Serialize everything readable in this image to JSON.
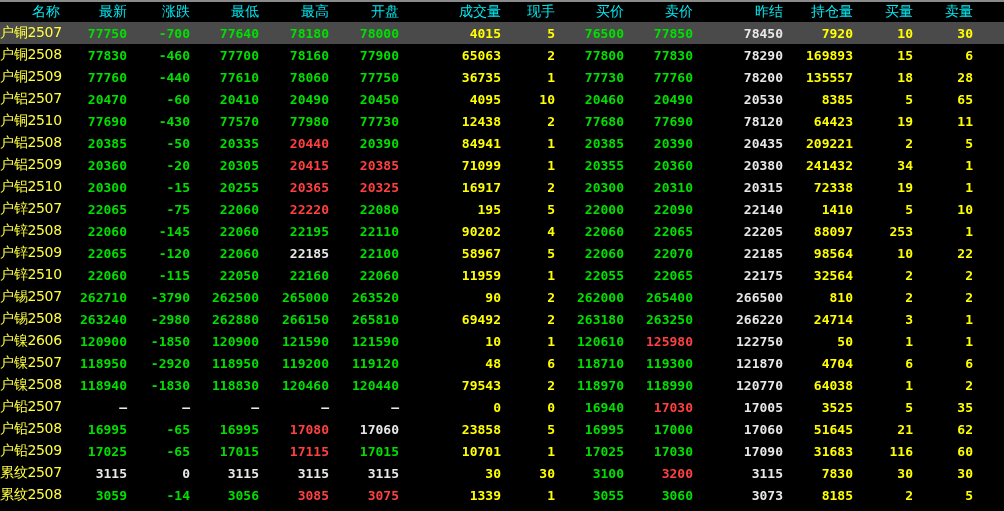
{
  "table": {
    "columns": [
      "名称",
      "最新",
      "涨跌",
      "最低",
      "最高",
      "开盘",
      "成交量",
      "现手",
      "买价",
      "卖价",
      "昨结",
      "持仓量",
      "买量",
      "卖量"
    ],
    "rows": [
      {
        "selected": true,
        "cells": [
          {
            "text": "户铜2507",
            "kind": "name"
          },
          {
            "text": "77750",
            "kind": "down"
          },
          {
            "text": "-700",
            "kind": "down"
          },
          {
            "text": "77640",
            "kind": "down"
          },
          {
            "text": "78180",
            "kind": "down"
          },
          {
            "text": "78000",
            "kind": "down"
          },
          {
            "text": "4015",
            "kind": "vol"
          },
          {
            "text": "5",
            "kind": "vol"
          },
          {
            "text": "76500",
            "kind": "down"
          },
          {
            "text": "77850",
            "kind": "down"
          },
          {
            "text": "78450",
            "kind": "flat"
          },
          {
            "text": "7920",
            "kind": "vol"
          },
          {
            "text": "10",
            "kind": "vol"
          },
          {
            "text": "30",
            "kind": "vol"
          }
        ]
      },
      {
        "selected": false,
        "cells": [
          {
            "text": "户铜2508",
            "kind": "name"
          },
          {
            "text": "77830",
            "kind": "down"
          },
          {
            "text": "-460",
            "kind": "down"
          },
          {
            "text": "77700",
            "kind": "down"
          },
          {
            "text": "78160",
            "kind": "down"
          },
          {
            "text": "77900",
            "kind": "down"
          },
          {
            "text": "65063",
            "kind": "vol"
          },
          {
            "text": "2",
            "kind": "vol"
          },
          {
            "text": "77800",
            "kind": "down"
          },
          {
            "text": "77830",
            "kind": "down"
          },
          {
            "text": "78290",
            "kind": "flat"
          },
          {
            "text": "169893",
            "kind": "vol"
          },
          {
            "text": "15",
            "kind": "vol"
          },
          {
            "text": "6",
            "kind": "vol"
          }
        ]
      },
      {
        "selected": false,
        "cells": [
          {
            "text": "户铜2509",
            "kind": "name"
          },
          {
            "text": "77760",
            "kind": "down"
          },
          {
            "text": "-440",
            "kind": "down"
          },
          {
            "text": "77610",
            "kind": "down"
          },
          {
            "text": "78060",
            "kind": "down"
          },
          {
            "text": "77750",
            "kind": "down"
          },
          {
            "text": "36735",
            "kind": "vol"
          },
          {
            "text": "1",
            "kind": "vol"
          },
          {
            "text": "77730",
            "kind": "down"
          },
          {
            "text": "77760",
            "kind": "down"
          },
          {
            "text": "78200",
            "kind": "flat"
          },
          {
            "text": "135557",
            "kind": "vol"
          },
          {
            "text": "18",
            "kind": "vol"
          },
          {
            "text": "28",
            "kind": "vol"
          }
        ]
      },
      {
        "selected": false,
        "cells": [
          {
            "text": "户铝2507",
            "kind": "name"
          },
          {
            "text": "20470",
            "kind": "down"
          },
          {
            "text": "-60",
            "kind": "down"
          },
          {
            "text": "20410",
            "kind": "down"
          },
          {
            "text": "20490",
            "kind": "down"
          },
          {
            "text": "20450",
            "kind": "down"
          },
          {
            "text": "4095",
            "kind": "vol"
          },
          {
            "text": "10",
            "kind": "vol"
          },
          {
            "text": "20460",
            "kind": "down"
          },
          {
            "text": "20490",
            "kind": "down"
          },
          {
            "text": "20530",
            "kind": "flat"
          },
          {
            "text": "8385",
            "kind": "vol"
          },
          {
            "text": "5",
            "kind": "vol"
          },
          {
            "text": "65",
            "kind": "vol"
          }
        ]
      },
      {
        "selected": false,
        "cells": [
          {
            "text": "户铜2510",
            "kind": "name"
          },
          {
            "text": "77690",
            "kind": "down"
          },
          {
            "text": "-430",
            "kind": "down"
          },
          {
            "text": "77570",
            "kind": "down"
          },
          {
            "text": "77980",
            "kind": "down"
          },
          {
            "text": "77730",
            "kind": "down"
          },
          {
            "text": "12438",
            "kind": "vol"
          },
          {
            "text": "2",
            "kind": "vol"
          },
          {
            "text": "77680",
            "kind": "down"
          },
          {
            "text": "77690",
            "kind": "down"
          },
          {
            "text": "78120",
            "kind": "flat"
          },
          {
            "text": "64423",
            "kind": "vol"
          },
          {
            "text": "19",
            "kind": "vol"
          },
          {
            "text": "11",
            "kind": "vol"
          }
        ]
      },
      {
        "selected": false,
        "cells": [
          {
            "text": "户铝2508",
            "kind": "name"
          },
          {
            "text": "20385",
            "kind": "down"
          },
          {
            "text": "-50",
            "kind": "down"
          },
          {
            "text": "20335",
            "kind": "down"
          },
          {
            "text": "20440",
            "kind": "up"
          },
          {
            "text": "20390",
            "kind": "down"
          },
          {
            "text": "84941",
            "kind": "vol"
          },
          {
            "text": "1",
            "kind": "vol"
          },
          {
            "text": "20385",
            "kind": "down"
          },
          {
            "text": "20390",
            "kind": "down"
          },
          {
            "text": "20435",
            "kind": "flat"
          },
          {
            "text": "209221",
            "kind": "vol"
          },
          {
            "text": "2",
            "kind": "vol"
          },
          {
            "text": "5",
            "kind": "vol"
          }
        ]
      },
      {
        "selected": false,
        "cells": [
          {
            "text": "户铝2509",
            "kind": "name"
          },
          {
            "text": "20360",
            "kind": "down"
          },
          {
            "text": "-20",
            "kind": "down"
          },
          {
            "text": "20305",
            "kind": "down"
          },
          {
            "text": "20415",
            "kind": "up"
          },
          {
            "text": "20385",
            "kind": "up"
          },
          {
            "text": "71099",
            "kind": "vol"
          },
          {
            "text": "1",
            "kind": "vol"
          },
          {
            "text": "20355",
            "kind": "down"
          },
          {
            "text": "20360",
            "kind": "down"
          },
          {
            "text": "20380",
            "kind": "flat"
          },
          {
            "text": "241432",
            "kind": "vol"
          },
          {
            "text": "34",
            "kind": "vol"
          },
          {
            "text": "1",
            "kind": "vol"
          }
        ]
      },
      {
        "selected": false,
        "cells": [
          {
            "text": "户铝2510",
            "kind": "name"
          },
          {
            "text": "20300",
            "kind": "down"
          },
          {
            "text": "-15",
            "kind": "down"
          },
          {
            "text": "20255",
            "kind": "down"
          },
          {
            "text": "20365",
            "kind": "up"
          },
          {
            "text": "20325",
            "kind": "up"
          },
          {
            "text": "16917",
            "kind": "vol"
          },
          {
            "text": "2",
            "kind": "vol"
          },
          {
            "text": "20300",
            "kind": "down"
          },
          {
            "text": "20310",
            "kind": "down"
          },
          {
            "text": "20315",
            "kind": "flat"
          },
          {
            "text": "72338",
            "kind": "vol"
          },
          {
            "text": "19",
            "kind": "vol"
          },
          {
            "text": "1",
            "kind": "vol"
          }
        ]
      },
      {
        "selected": false,
        "cells": [
          {
            "text": "户锌2507",
            "kind": "name"
          },
          {
            "text": "22065",
            "kind": "down"
          },
          {
            "text": "-75",
            "kind": "down"
          },
          {
            "text": "22060",
            "kind": "down"
          },
          {
            "text": "22220",
            "kind": "up"
          },
          {
            "text": "22080",
            "kind": "down"
          },
          {
            "text": "195",
            "kind": "vol"
          },
          {
            "text": "5",
            "kind": "vol"
          },
          {
            "text": "22000",
            "kind": "down"
          },
          {
            "text": "22090",
            "kind": "down"
          },
          {
            "text": "22140",
            "kind": "flat"
          },
          {
            "text": "1410",
            "kind": "vol"
          },
          {
            "text": "5",
            "kind": "vol"
          },
          {
            "text": "10",
            "kind": "vol"
          }
        ]
      },
      {
        "selected": false,
        "cells": [
          {
            "text": "户锌2508",
            "kind": "name"
          },
          {
            "text": "22060",
            "kind": "down"
          },
          {
            "text": "-145",
            "kind": "down"
          },
          {
            "text": "22060",
            "kind": "down"
          },
          {
            "text": "22195",
            "kind": "down"
          },
          {
            "text": "22110",
            "kind": "down"
          },
          {
            "text": "90202",
            "kind": "vol"
          },
          {
            "text": "4",
            "kind": "vol"
          },
          {
            "text": "22060",
            "kind": "down"
          },
          {
            "text": "22065",
            "kind": "down"
          },
          {
            "text": "22205",
            "kind": "flat"
          },
          {
            "text": "88097",
            "kind": "vol"
          },
          {
            "text": "253",
            "kind": "vol"
          },
          {
            "text": "1",
            "kind": "vol"
          }
        ]
      },
      {
        "selected": false,
        "cells": [
          {
            "text": "户锌2509",
            "kind": "name"
          },
          {
            "text": "22065",
            "kind": "down"
          },
          {
            "text": "-120",
            "kind": "down"
          },
          {
            "text": "22060",
            "kind": "down"
          },
          {
            "text": "22185",
            "kind": "flat"
          },
          {
            "text": "22100",
            "kind": "down"
          },
          {
            "text": "58967",
            "kind": "vol"
          },
          {
            "text": "5",
            "kind": "vol"
          },
          {
            "text": "22060",
            "kind": "down"
          },
          {
            "text": "22070",
            "kind": "down"
          },
          {
            "text": "22185",
            "kind": "flat"
          },
          {
            "text": "98564",
            "kind": "vol"
          },
          {
            "text": "10",
            "kind": "vol"
          },
          {
            "text": "22",
            "kind": "vol"
          }
        ]
      },
      {
        "selected": false,
        "cells": [
          {
            "text": "户锌2510",
            "kind": "name"
          },
          {
            "text": "22060",
            "kind": "down"
          },
          {
            "text": "-115",
            "kind": "down"
          },
          {
            "text": "22050",
            "kind": "down"
          },
          {
            "text": "22160",
            "kind": "down"
          },
          {
            "text": "22060",
            "kind": "down"
          },
          {
            "text": "11959",
            "kind": "vol"
          },
          {
            "text": "1",
            "kind": "vol"
          },
          {
            "text": "22055",
            "kind": "down"
          },
          {
            "text": "22065",
            "kind": "down"
          },
          {
            "text": "22175",
            "kind": "flat"
          },
          {
            "text": "32564",
            "kind": "vol"
          },
          {
            "text": "2",
            "kind": "vol"
          },
          {
            "text": "2",
            "kind": "vol"
          }
        ]
      },
      {
        "selected": false,
        "cells": [
          {
            "text": "户锡2507",
            "kind": "name"
          },
          {
            "text": "262710",
            "kind": "down"
          },
          {
            "text": "-3790",
            "kind": "down"
          },
          {
            "text": "262500",
            "kind": "down"
          },
          {
            "text": "265000",
            "kind": "down"
          },
          {
            "text": "263520",
            "kind": "down"
          },
          {
            "text": "90",
            "kind": "vol"
          },
          {
            "text": "2",
            "kind": "vol"
          },
          {
            "text": "262000",
            "kind": "down"
          },
          {
            "text": "265400",
            "kind": "down"
          },
          {
            "text": "266500",
            "kind": "flat"
          },
          {
            "text": "810",
            "kind": "vol"
          },
          {
            "text": "2",
            "kind": "vol"
          },
          {
            "text": "2",
            "kind": "vol"
          }
        ]
      },
      {
        "selected": false,
        "cells": [
          {
            "text": "户锡2508",
            "kind": "name"
          },
          {
            "text": "263240",
            "kind": "down"
          },
          {
            "text": "-2980",
            "kind": "down"
          },
          {
            "text": "262880",
            "kind": "down"
          },
          {
            "text": "266150",
            "kind": "down"
          },
          {
            "text": "265810",
            "kind": "down"
          },
          {
            "text": "69492",
            "kind": "vol"
          },
          {
            "text": "2",
            "kind": "vol"
          },
          {
            "text": "263180",
            "kind": "down"
          },
          {
            "text": "263250",
            "kind": "down"
          },
          {
            "text": "266220",
            "kind": "flat"
          },
          {
            "text": "24714",
            "kind": "vol"
          },
          {
            "text": "3",
            "kind": "vol"
          },
          {
            "text": "1",
            "kind": "vol"
          }
        ]
      },
      {
        "selected": false,
        "cells": [
          {
            "text": "户镍2606",
            "kind": "name"
          },
          {
            "text": "120900",
            "kind": "down"
          },
          {
            "text": "-1850",
            "kind": "down"
          },
          {
            "text": "120900",
            "kind": "down"
          },
          {
            "text": "121590",
            "kind": "down"
          },
          {
            "text": "121590",
            "kind": "down"
          },
          {
            "text": "10",
            "kind": "vol"
          },
          {
            "text": "1",
            "kind": "vol"
          },
          {
            "text": "120610",
            "kind": "down"
          },
          {
            "text": "125980",
            "kind": "up"
          },
          {
            "text": "122750",
            "kind": "flat"
          },
          {
            "text": "50",
            "kind": "vol"
          },
          {
            "text": "1",
            "kind": "vol"
          },
          {
            "text": "1",
            "kind": "vol"
          }
        ]
      },
      {
        "selected": false,
        "cells": [
          {
            "text": "户镍2507",
            "kind": "name"
          },
          {
            "text": "118950",
            "kind": "down"
          },
          {
            "text": "-2920",
            "kind": "down"
          },
          {
            "text": "118950",
            "kind": "down"
          },
          {
            "text": "119200",
            "kind": "down"
          },
          {
            "text": "119120",
            "kind": "down"
          },
          {
            "text": "48",
            "kind": "vol"
          },
          {
            "text": "6",
            "kind": "vol"
          },
          {
            "text": "118710",
            "kind": "down"
          },
          {
            "text": "119300",
            "kind": "down"
          },
          {
            "text": "121870",
            "kind": "flat"
          },
          {
            "text": "4704",
            "kind": "vol"
          },
          {
            "text": "6",
            "kind": "vol"
          },
          {
            "text": "6",
            "kind": "vol"
          }
        ]
      },
      {
        "selected": false,
        "cells": [
          {
            "text": "户镍2508",
            "kind": "name"
          },
          {
            "text": "118940",
            "kind": "down"
          },
          {
            "text": "-1830",
            "kind": "down"
          },
          {
            "text": "118830",
            "kind": "down"
          },
          {
            "text": "120460",
            "kind": "down"
          },
          {
            "text": "120440",
            "kind": "down"
          },
          {
            "text": "79543",
            "kind": "vol"
          },
          {
            "text": "2",
            "kind": "vol"
          },
          {
            "text": "118970",
            "kind": "down"
          },
          {
            "text": "118990",
            "kind": "down"
          },
          {
            "text": "120770",
            "kind": "flat"
          },
          {
            "text": "64038",
            "kind": "vol"
          },
          {
            "text": "1",
            "kind": "vol"
          },
          {
            "text": "2",
            "kind": "vol"
          }
        ]
      },
      {
        "selected": false,
        "cells": [
          {
            "text": "户铅2507",
            "kind": "name"
          },
          {
            "text": "—",
            "kind": "flat"
          },
          {
            "text": "—",
            "kind": "flat"
          },
          {
            "text": "—",
            "kind": "flat"
          },
          {
            "text": "—",
            "kind": "flat"
          },
          {
            "text": "—",
            "kind": "flat"
          },
          {
            "text": "0",
            "kind": "vol"
          },
          {
            "text": "0",
            "kind": "vol"
          },
          {
            "text": "16940",
            "kind": "down"
          },
          {
            "text": "17030",
            "kind": "up"
          },
          {
            "text": "17005",
            "kind": "flat"
          },
          {
            "text": "3525",
            "kind": "vol"
          },
          {
            "text": "5",
            "kind": "vol"
          },
          {
            "text": "35",
            "kind": "vol"
          }
        ]
      },
      {
        "selected": false,
        "cells": [
          {
            "text": "户铅2508",
            "kind": "name"
          },
          {
            "text": "16995",
            "kind": "down"
          },
          {
            "text": "-65",
            "kind": "down"
          },
          {
            "text": "16995",
            "kind": "down"
          },
          {
            "text": "17080",
            "kind": "up"
          },
          {
            "text": "17060",
            "kind": "flat"
          },
          {
            "text": "23858",
            "kind": "vol"
          },
          {
            "text": "5",
            "kind": "vol"
          },
          {
            "text": "16995",
            "kind": "down"
          },
          {
            "text": "17000",
            "kind": "down"
          },
          {
            "text": "17060",
            "kind": "flat"
          },
          {
            "text": "51645",
            "kind": "vol"
          },
          {
            "text": "21",
            "kind": "vol"
          },
          {
            "text": "62",
            "kind": "vol"
          }
        ]
      },
      {
        "selected": false,
        "cells": [
          {
            "text": "户铅2509",
            "kind": "name"
          },
          {
            "text": "17025",
            "kind": "down"
          },
          {
            "text": "-65",
            "kind": "down"
          },
          {
            "text": "17015",
            "kind": "down"
          },
          {
            "text": "17115",
            "kind": "up"
          },
          {
            "text": "17015",
            "kind": "down"
          },
          {
            "text": "10701",
            "kind": "vol"
          },
          {
            "text": "1",
            "kind": "vol"
          },
          {
            "text": "17025",
            "kind": "down"
          },
          {
            "text": "17030",
            "kind": "down"
          },
          {
            "text": "17090",
            "kind": "flat"
          },
          {
            "text": "31683",
            "kind": "vol"
          },
          {
            "text": "116",
            "kind": "vol"
          },
          {
            "text": "60",
            "kind": "vol"
          }
        ]
      },
      {
        "selected": false,
        "cells": [
          {
            "text": "累纹2507",
            "kind": "name"
          },
          {
            "text": "3115",
            "kind": "flat"
          },
          {
            "text": "0",
            "kind": "flat"
          },
          {
            "text": "3115",
            "kind": "flat"
          },
          {
            "text": "3115",
            "kind": "flat"
          },
          {
            "text": "3115",
            "kind": "flat"
          },
          {
            "text": "30",
            "kind": "vol"
          },
          {
            "text": "30",
            "kind": "vol"
          },
          {
            "text": "3100",
            "kind": "down"
          },
          {
            "text": "3200",
            "kind": "up"
          },
          {
            "text": "3115",
            "kind": "flat"
          },
          {
            "text": "7830",
            "kind": "vol"
          },
          {
            "text": "30",
            "kind": "vol"
          },
          {
            "text": "30",
            "kind": "vol"
          }
        ]
      },
      {
        "selected": false,
        "cells": [
          {
            "text": "累纹2508",
            "kind": "name"
          },
          {
            "text": "3059",
            "kind": "down"
          },
          {
            "text": "-14",
            "kind": "down"
          },
          {
            "text": "3056",
            "kind": "down"
          },
          {
            "text": "3085",
            "kind": "up"
          },
          {
            "text": "3075",
            "kind": "up"
          },
          {
            "text": "1339",
            "kind": "vol"
          },
          {
            "text": "1",
            "kind": "vol"
          },
          {
            "text": "3055",
            "kind": "down"
          },
          {
            "text": "3060",
            "kind": "down"
          },
          {
            "text": "3073",
            "kind": "flat"
          },
          {
            "text": "8185",
            "kind": "vol"
          },
          {
            "text": "2",
            "kind": "vol"
          },
          {
            "text": "5",
            "kind": "vol"
          }
        ]
      }
    ]
  }
}
